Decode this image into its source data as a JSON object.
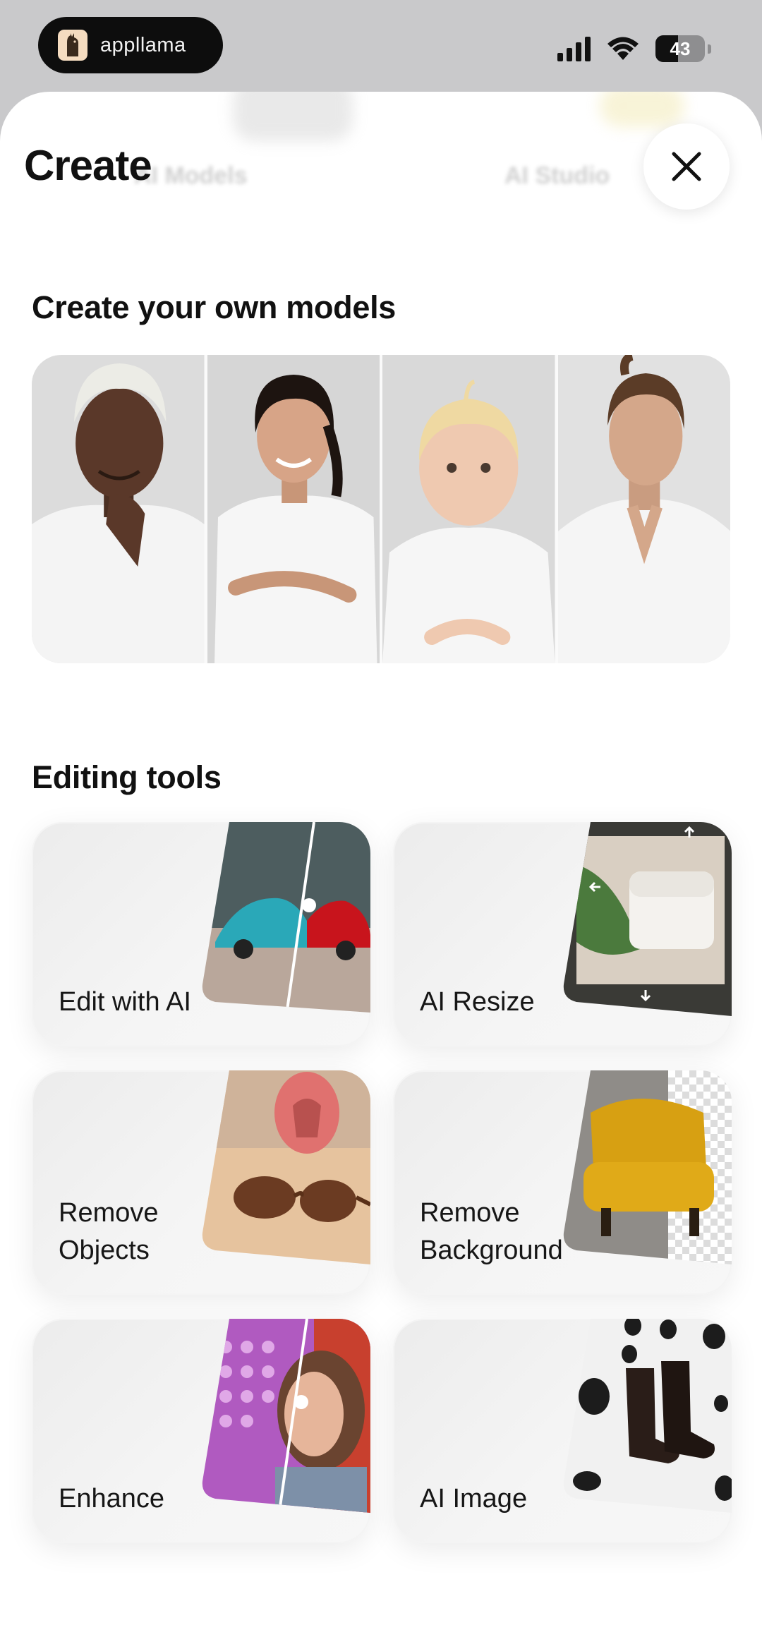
{
  "status_bar": {
    "app_name": "appllama",
    "battery": "43"
  },
  "background_tabs": [
    "AI Models",
    "AI Studio"
  ],
  "sheet": {
    "title": "Create",
    "close_icon": "close-x-icon"
  },
  "models_section": {
    "title": "Create your own models",
    "models": [
      "model-man-white-hair",
      "model-pregnant-woman",
      "model-toddler",
      "model-man-ponytail"
    ]
  },
  "tools_section": {
    "title": "Editing tools",
    "tools": [
      {
        "label": "Edit with AI",
        "icon": "car-before-after-thumbnail"
      },
      {
        "label": "AI Resize",
        "icon": "cream-jar-resize-thumbnail"
      },
      {
        "label": "Remove\nObjects",
        "icon": "sunglasses-thumbnail"
      },
      {
        "label": "Remove\nBackground",
        "icon": "yellow-armchair-thumbnail"
      },
      {
        "label": "Enhance",
        "icon": "portrait-before-after-thumbnail"
      },
      {
        "label": "AI Image",
        "icon": "boots-balloons-thumbnail"
      }
    ]
  },
  "colors": {
    "sheet_bg": "#ffffff",
    "app_pill_bg": "#0d0d0d",
    "card_bg": "#f0f0f0",
    "text": "#111111"
  }
}
